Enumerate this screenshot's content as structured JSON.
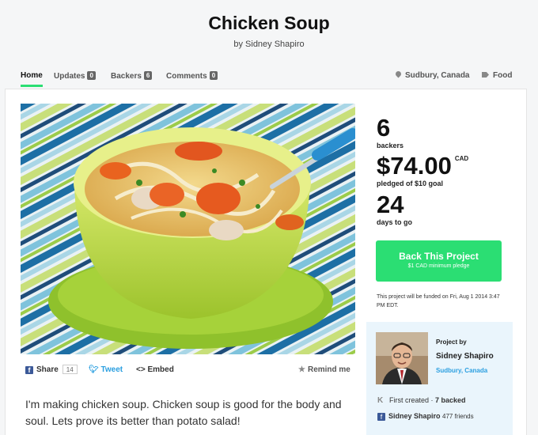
{
  "header": {
    "title": "Chicken Soup",
    "byline": "by Sidney Shapiro"
  },
  "nav": {
    "tabs": [
      {
        "label": "Home",
        "count": ""
      },
      {
        "label": "Updates",
        "count": "0"
      },
      {
        "label": "Backers",
        "count": "6"
      },
      {
        "label": "Comments",
        "count": "0"
      }
    ],
    "location": "Sudbury, Canada",
    "category": "Food"
  },
  "share": {
    "share_label": "Share",
    "share_count": "14",
    "tweet_label": "Tweet",
    "embed_label": "Embed",
    "remind_label": "Remind me"
  },
  "description": "I'm making chicken soup. Chicken soup is good for the body and soul. Lets prove its better than potato salad!",
  "stats": {
    "backers_value": "6",
    "backers_label": "backers",
    "pledged_value": "$74.00",
    "pledged_currency": "CAD",
    "pledged_label": "pledged of $10 goal",
    "days_value": "24",
    "days_label": "days to go"
  },
  "cta": {
    "label": "Back This Project",
    "sublabel": "$1 CAD minimum pledge"
  },
  "funding_note": "This project will be funded on Fri, Aug 1 2014 3:47 PM EDT.",
  "creator": {
    "project_by": "Project by",
    "name": "Sidney Shapiro",
    "location": "Sudbury, Canada",
    "created_text": "First created ·",
    "backed_text": "7 backed",
    "fb_name": "Sidney Shapiro",
    "fb_friends": "477 friends"
  },
  "colors": {
    "accent": "#2bde73",
    "link": "#2b9fe0",
    "creator_bg": "#eaf5fc"
  }
}
